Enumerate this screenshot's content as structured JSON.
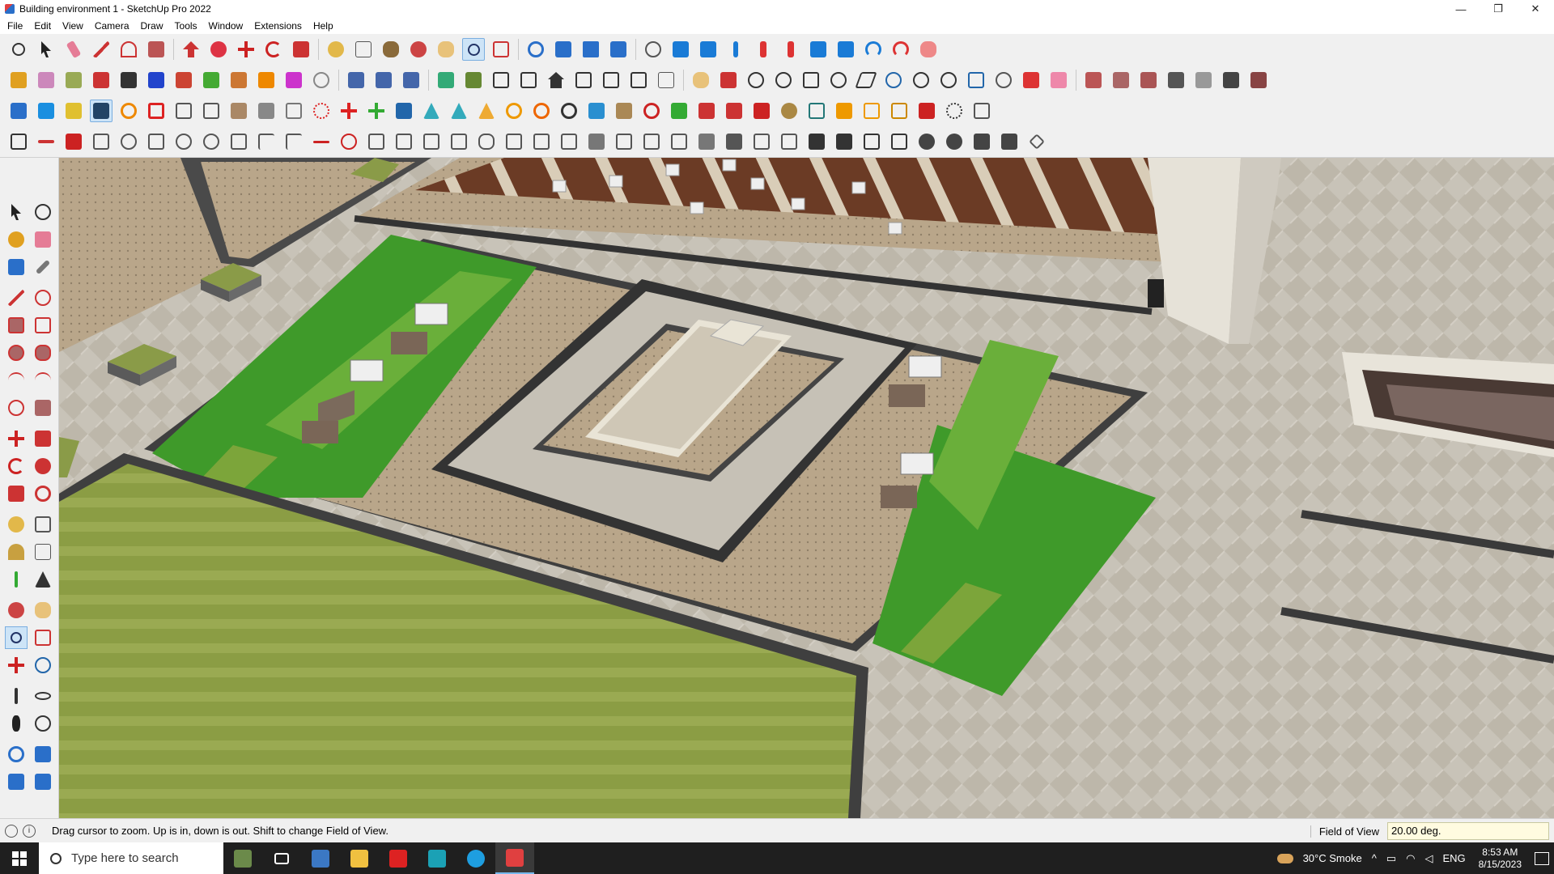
{
  "window": {
    "title": "Building environment 1 - SketchUp Pro 2022",
    "controls": [
      "—",
      "❐",
      "✕"
    ]
  },
  "menu": [
    "File",
    "Edit",
    "View",
    "Camera",
    "Draw",
    "Tools",
    "Window",
    "Extensions",
    "Help"
  ],
  "status": {
    "message": "Drag cursor to zoom.  Up is in, down is out. Shift to change Field of View.",
    "measure_label": "Field of View",
    "measure_value": "20.00 deg."
  },
  "taskbar": {
    "search_placeholder": "Type here to search",
    "weather": "30°C  Smoke",
    "language": "ENG",
    "time": "8:53 AM",
    "date": "8/15/2023"
  },
  "colors": {
    "grass": "#3e9a2a",
    "lawn": "#8ea247",
    "paving": "#b6a48a",
    "tiles": "#c9c3b6",
    "dark_border": "#3c3c3c",
    "deck": "#6b3b25",
    "accent_active": "#cde4f7"
  }
}
